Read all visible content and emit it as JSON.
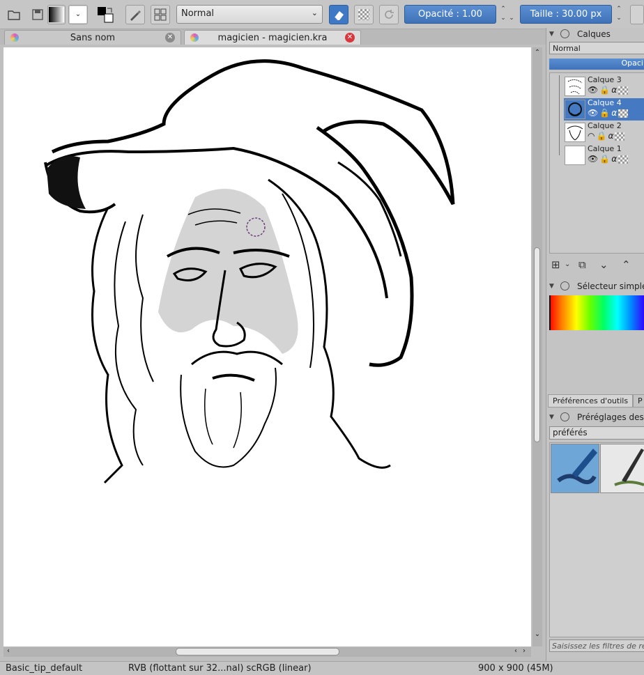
{
  "toolbar": {
    "blend_mode": "Normal",
    "opacity_label": "Opacité :",
    "opacity_value": "1.00",
    "size_label": "Taille :",
    "size_value": "30.00 px"
  },
  "tabs": [
    {
      "label": "Sans nom",
      "active": false
    },
    {
      "label": "magicien - magicien.kra",
      "active": true
    }
  ],
  "status": {
    "brush": "Basic_tip_default",
    "colorspace": "RVB (flottant sur 32...nal)  scRGB (linear)",
    "dimensions": "900 x 900 (45M)"
  },
  "layers_panel": {
    "title": "Calques",
    "blend_mode": "Normal",
    "opacity_label": "Opaci",
    "layers": [
      {
        "name": "Calque 3",
        "selected": false
      },
      {
        "name": "Calque 4",
        "selected": true
      },
      {
        "name": "Calque 2",
        "selected": false
      },
      {
        "name": "Calque 1",
        "selected": false
      }
    ]
  },
  "color_selector": {
    "title": "Sélecteur simple d"
  },
  "bottom_tabs": [
    "Préférences d'outils",
    "P"
  ],
  "presets": {
    "title": "Préréglages des b",
    "tag": "préférés",
    "filter_placeholder": "Saisissez les filtres de re"
  },
  "colors": {
    "accent": "#3f79c6",
    "close_red": "#d9363e",
    "panel_bg": "#c4c4c4"
  }
}
